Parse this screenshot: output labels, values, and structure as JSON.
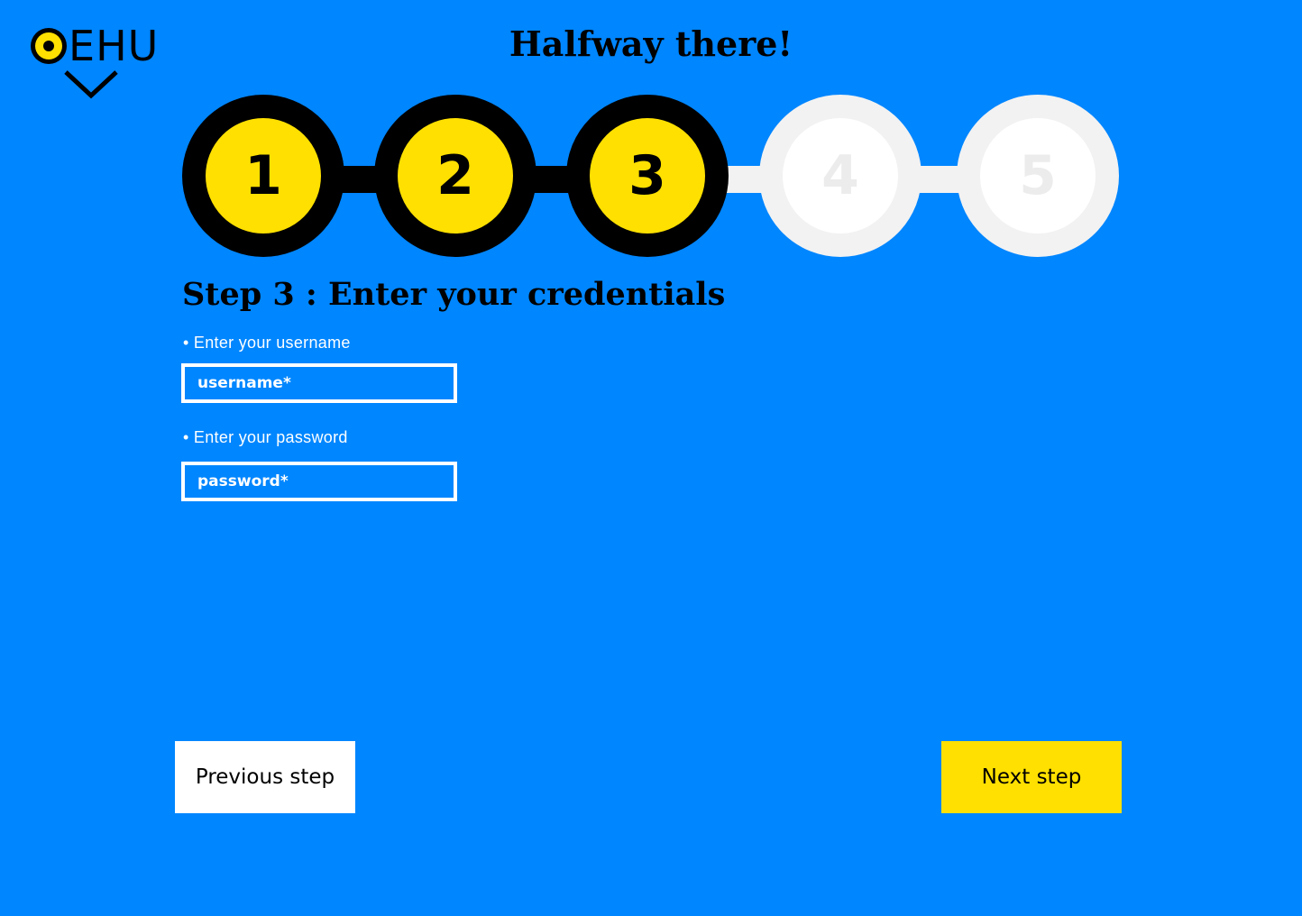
{
  "brand": {
    "logo_text": "EHU"
  },
  "header": {
    "title": "Halfway there!"
  },
  "stepper": {
    "current": 3,
    "steps": [
      {
        "label": "1",
        "state": "done"
      },
      {
        "label": "2",
        "state": "done"
      },
      {
        "label": "3",
        "state": "done"
      },
      {
        "label": "4",
        "state": "todo"
      },
      {
        "label": "5",
        "state": "todo"
      }
    ]
  },
  "form": {
    "heading": "Step 3 : Enter your credentials",
    "username": {
      "label": "• Enter your username",
      "placeholder": "username*",
      "value": ""
    },
    "password": {
      "label": "• Enter your password",
      "placeholder": "password*",
      "value": ""
    }
  },
  "actions": {
    "previous_label": "Previous step",
    "next_label": "Next step"
  },
  "colors": {
    "background": "#0086ff",
    "accent_yellow": "#ffe000",
    "step_done_ring": "#000000",
    "step_todo_ring": "#f2f2f2"
  },
  "icons": {
    "logo_eye": "eye-icon",
    "logo_chevron": "chevron-down-icon"
  }
}
